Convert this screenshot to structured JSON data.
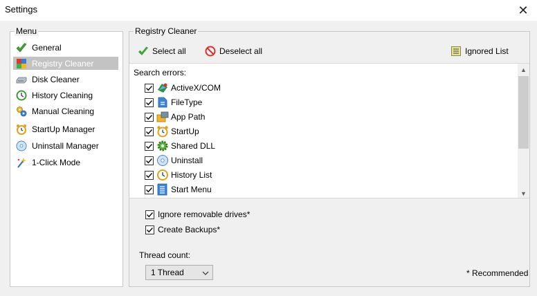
{
  "window": {
    "title": "Settings",
    "close_label": "✕"
  },
  "menu": {
    "label": "Menu",
    "items": [
      {
        "label": "General",
        "icon": "check-icon"
      },
      {
        "label": "Registry Cleaner",
        "icon": "registry-cubes-icon",
        "selected": true
      },
      {
        "label": "Disk Cleaner",
        "icon": "disk-icon"
      },
      {
        "label": "History Cleaning",
        "icon": "history-icon"
      },
      {
        "label": "Manual Cleaning",
        "icon": "gears-icon"
      },
      {
        "label": "StartUp Manager",
        "icon": "alarm-clock-icon"
      },
      {
        "label": "Uninstall Manager",
        "icon": "cd-icon"
      },
      {
        "label": "1-Click Mode",
        "icon": "magic-wand-icon"
      }
    ]
  },
  "registry": {
    "label": "Registry Cleaner",
    "select_all": "Select all",
    "deselect_all": "Deselect all",
    "ignored_list": "Ignored List",
    "search_errors": "Search errors:",
    "items": [
      {
        "label": "ActiveX/COM",
        "checked": true
      },
      {
        "label": "FileType",
        "checked": true
      },
      {
        "label": "App Path",
        "checked": true
      },
      {
        "label": "StartUp",
        "checked": true
      },
      {
        "label": "Shared DLL",
        "checked": true
      },
      {
        "label": "Uninstall",
        "checked": true
      },
      {
        "label": "History List",
        "checked": true
      },
      {
        "label": "Start Menu",
        "checked": true
      }
    ]
  },
  "options": {
    "ignore_removable": "Ignore removable drives*",
    "create_backups": "Create Backups*",
    "thread_count_label": "Thread count:",
    "thread_count_value": "1 Thread",
    "recommended": "* Recommended"
  },
  "colors": {
    "selected_bg": "#c3c3c3",
    "panel_bg": "#ffffff",
    "window_bg": "#f0f0f0"
  }
}
